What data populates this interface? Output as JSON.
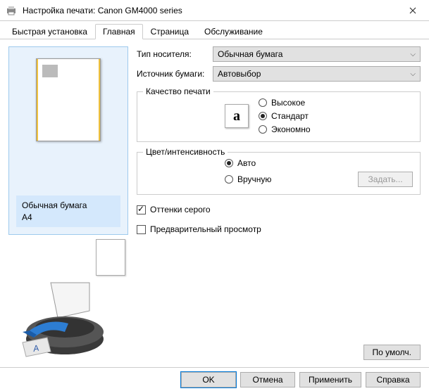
{
  "window": {
    "title": "Настройка печати: Canon GM4000 series"
  },
  "tabs": {
    "quick": "Быстрая установка",
    "main": "Главная",
    "page": "Страница",
    "service": "Обслуживание"
  },
  "preview": {
    "media": "Обычная бумага",
    "size": "A4"
  },
  "fields": {
    "media_type_label": "Тип носителя:",
    "media_type_value": "Обычная бумага",
    "paper_source_label": "Источник бумаги:",
    "paper_source_value": "Автовыбор"
  },
  "quality": {
    "group_label": "Качество печати",
    "high": "Высокое",
    "standard": "Стандарт",
    "economy": "Экономно",
    "selected": "standard"
  },
  "color": {
    "group_label": "Цвет/интенсивность",
    "auto": "Авто",
    "manual": "Вручную",
    "selected": "auto",
    "set_button": "Задать..."
  },
  "checkboxes": {
    "grayscale": "Оттенки серого",
    "grayscale_checked": true,
    "preview": "Предварительный просмотр",
    "preview_checked": false
  },
  "buttons": {
    "defaults": "По умолч.",
    "ok": "OK",
    "cancel": "Отмена",
    "apply": "Применить",
    "help": "Справка"
  }
}
